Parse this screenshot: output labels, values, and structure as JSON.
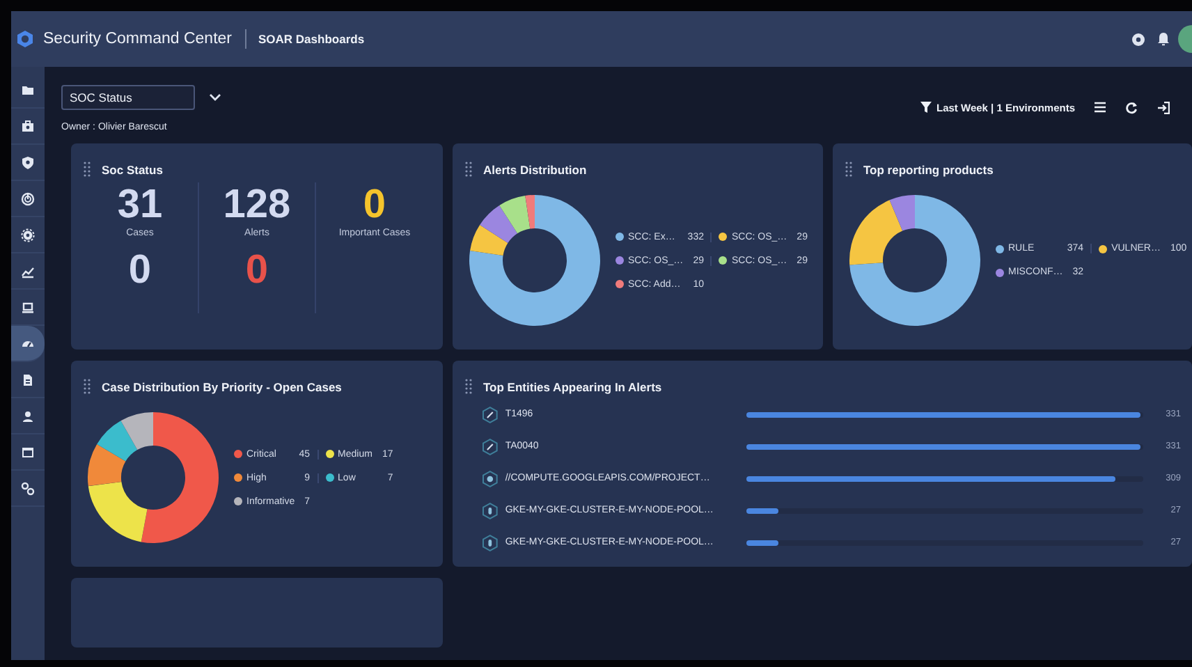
{
  "header": {
    "product": "Security Command Center",
    "section": "SOAR Dashboards"
  },
  "sidebar": {
    "items": [
      {
        "selected": false
      },
      {
        "selected": false
      },
      {
        "selected": false
      },
      {
        "selected": false
      },
      {
        "selected": false
      },
      {
        "selected": false
      },
      {
        "selected": false
      },
      {
        "selected": true
      },
      {
        "selected": false
      },
      {
        "selected": false
      },
      {
        "selected": false
      },
      {
        "selected": false
      }
    ]
  },
  "toolbar": {
    "dashboard": "SOC Status",
    "owner": "Owner : Olivier Barescut",
    "filter": "Last Week | 1 Environments"
  },
  "widgets": [
    {
      "kind": "stats",
      "title": "Soc Status",
      "metrics": [
        {
          "value": "31",
          "label": "Cases",
          "color": "#d3daf0"
        },
        {
          "value": "128",
          "label": "Alerts",
          "color": "#d3daf0"
        },
        {
          "value": "0",
          "label": "Important Cases",
          "color": "#f5c42c"
        },
        {
          "value": "0",
          "color": "#d3daf0"
        },
        {
          "value": "0",
          "color": "#e8524a"
        }
      ]
    },
    {
      "kind": "donut",
      "title": "Alerts Distribution",
      "chart_data": {
        "type": "donut",
        "categories": [
          "SCC: Ex…",
          "SCC: OS_…",
          "SCC: OS_…",
          "SCC: OS_…",
          "SCC: Add…"
        ],
        "values": [
          332,
          29,
          29,
          29,
          10
        ],
        "legend": "right",
        "data_labels": true,
        "colors": [
          "#7fb8e6",
          "#f5c542",
          "#9b86e0",
          "#a8e08a",
          "#f07b7b"
        ]
      }
    },
    {
      "kind": "donut",
      "title": "Top reporting products",
      "chart_data": {
        "type": "donut",
        "categories": [
          "RULE",
          "VULNER…",
          "MISCONF…"
        ],
        "values": [
          374,
          100,
          32
        ],
        "legend": "right",
        "data_labels": true,
        "colors": [
          "#7fb8e6",
          "#f5c542",
          "#9b86e0"
        ]
      }
    },
    {
      "kind": "donut",
      "title": "Case Distribution By Priority - Open Cases",
      "chart_data": {
        "type": "donut",
        "categories": [
          "Critical",
          "Medium",
          "High",
          "Low",
          "Informative"
        ],
        "values": [
          45,
          17,
          9,
          7,
          7
        ],
        "legend": "right",
        "data_labels": true,
        "colors": [
          "#f0584a",
          "#ede34a",
          "#f0893a",
          "#3bbccc",
          "#b5b5bb"
        ]
      }
    },
    {
      "kind": "entities",
      "title": "Top Entities Appearing In Alerts",
      "items": [
        {
          "kind": "technique",
          "label": "T1496",
          "value": "331",
          "level": 0.99
        },
        {
          "kind": "technique",
          "label": "TA0040",
          "value": "331",
          "level": 0.99
        },
        {
          "kind": "resource",
          "label": "//COMPUTE.GOOGLEAPIS.COM/PROJECT…",
          "value": "309",
          "level": 0.93
        },
        {
          "kind": "host",
          "label": "GKE-MY-GKE-CLUSTER-E-MY-NODE-POOL…",
          "value": "27",
          "level": 0.08
        },
        {
          "kind": "host",
          "label": "GKE-MY-GKE-CLUSTER-E-MY-NODE-POOL…",
          "value": "27",
          "level": 0.08
        }
      ]
    },
    {
      "kind": "empty"
    }
  ]
}
